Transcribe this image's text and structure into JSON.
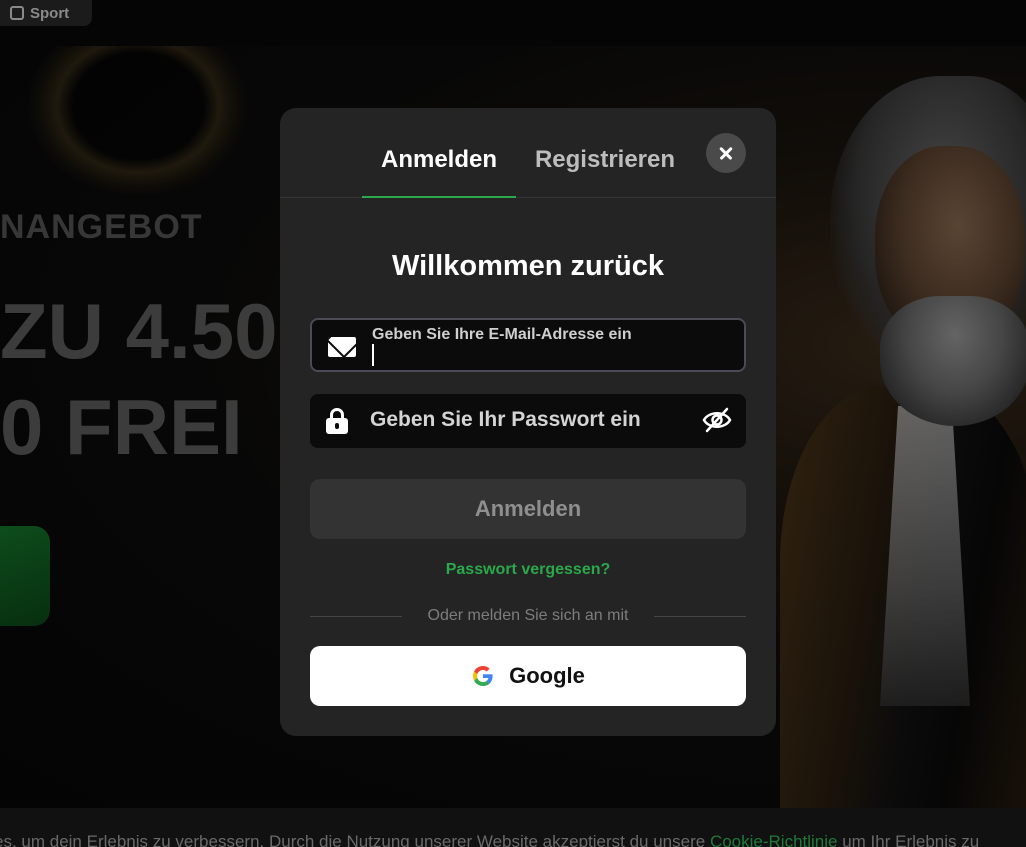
{
  "topbar": {
    "sport_label": "Sport"
  },
  "hero": {
    "line1": "NANGEBOT",
    "line2": "ZU 4.50",
    "line3": "0 FREI"
  },
  "modal": {
    "tabs": [
      {
        "label": "Anmelden",
        "active": true
      },
      {
        "label": "Registrieren",
        "active": false
      }
    ],
    "welcome_title": "Willkommen zurück",
    "email": {
      "value": "",
      "placeholder": "Geben Sie Ihre E-Mail-Adresse ein"
    },
    "password": {
      "value": "",
      "placeholder": "Geben Sie Ihr Passwort ein"
    },
    "login_button": "Anmelden",
    "forgot_link": "Passwort vergessen?",
    "divider_text": "Oder melden Sie sich an mit",
    "google_button": "Google"
  },
  "cookie_bar": {
    "text_before": "es, um dein Erlebnis zu verbessern. Durch die Nutzung unserer Website akzeptierst du unsere ",
    "link": "Cookie-Richtlinie",
    "text_after": " um Ihr Erlebnis zu"
  },
  "colors": {
    "accent": "#2aa84a",
    "modal_bg": "#242424",
    "input_bg": "#0b0b0b",
    "button_disabled": "#333333"
  },
  "icons": [
    "grid-icon",
    "close-icon",
    "mail-icon",
    "lock-icon",
    "eye-off-icon",
    "google-icon"
  ]
}
